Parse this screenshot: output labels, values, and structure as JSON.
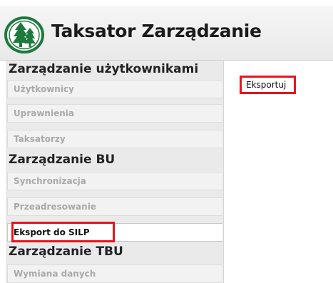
{
  "app": {
    "title": "Taksator Zarządzanie",
    "logo_icon": "tree-logo-icon"
  },
  "sidebar": {
    "sections": [
      {
        "title": "Zarządzanie użytkownikami",
        "items": [
          "Użytkownicy",
          "Uprawnienia",
          "Taksatorzy"
        ]
      },
      {
        "title": "Zarządzanie BU",
        "items": [
          "Synchronizacja",
          "Przeadresowanie",
          "Eksport do SILP"
        ]
      },
      {
        "title": "Zarządzanie TBU",
        "items": [
          "Wymiana danych"
        ]
      }
    ],
    "active_item": "Eksport do SILP"
  },
  "main": {
    "export_label": "Eksportuj"
  },
  "colors": {
    "highlight": "#e4151f",
    "logo_green": "#1e7a3c",
    "header_bg": "#eeeeee",
    "sidebar_bg": "#eaeaea"
  }
}
